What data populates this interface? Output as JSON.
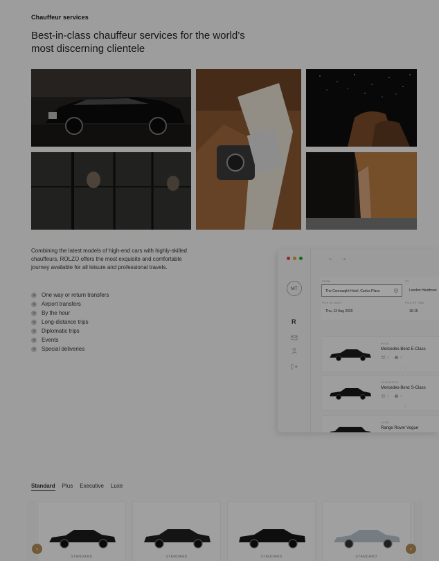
{
  "section": {
    "eyebrow": "Chauffeur services",
    "headline": "Best-in-class chauffeur services for the world’s most discerning clientele"
  },
  "intro_text": "Combining the latest models of high-end cars with highly-skilled chauffeurs, ROLZO offers the most exquisite and comfortable journey available for all leisure and professional travels.",
  "features": [
    "One way or return transfers",
    "Airport transfers",
    "By the hour",
    "Long-distance trips",
    "Diplomatic trips",
    "Events",
    "Special deliveries"
  ],
  "app_mockup": {
    "traffic_lights": [
      "#e0443e",
      "#dea123",
      "#1aab29"
    ],
    "avatar_initials": "MT",
    "logo_letter": "R",
    "from_label": "FROM",
    "from_value": "The Connaught Hotel, Carlos Place",
    "to_label": "TO",
    "to_value": "London Heathrow",
    "date_label": "PICK UP DATE",
    "date_value": "Thu, 13 Aug 2020",
    "time_label": "PICK UP TIME",
    "time_value": "16:15",
    "cars": [
      {
        "tier": "PLUS",
        "model": "Mercedes-Benz E-Class",
        "passengers": "2",
        "luggage": "2",
        "dot": "1"
      },
      {
        "tier": "EXECUTIVE",
        "model": "Mercedes-Benz S-Class",
        "passengers": "3",
        "luggage": "2",
        "dot": "1"
      },
      {
        "tier": "LUXE",
        "model": "Range Rover Vogue",
        "passengers": "3",
        "luggage": "3",
        "dot": "1"
      }
    ]
  },
  "tabs": [
    "Standard",
    "Plus",
    "Executive",
    "Luxe"
  ],
  "active_tab": "Standard",
  "carousel": {
    "cards": [
      {
        "label": "STANDARD",
        "color": "#1b1b1b"
      },
      {
        "label": "STANDARD",
        "color": "#202020"
      },
      {
        "label": "STANDARD",
        "color": "#161616"
      },
      {
        "label": "STANDARD",
        "color": "#b7c3cc"
      }
    ],
    "prev_symbol": "‹",
    "next_symbol": "›",
    "accent": "#b08d57"
  },
  "overlay_color": "rgba(0,0,0,0.36)"
}
